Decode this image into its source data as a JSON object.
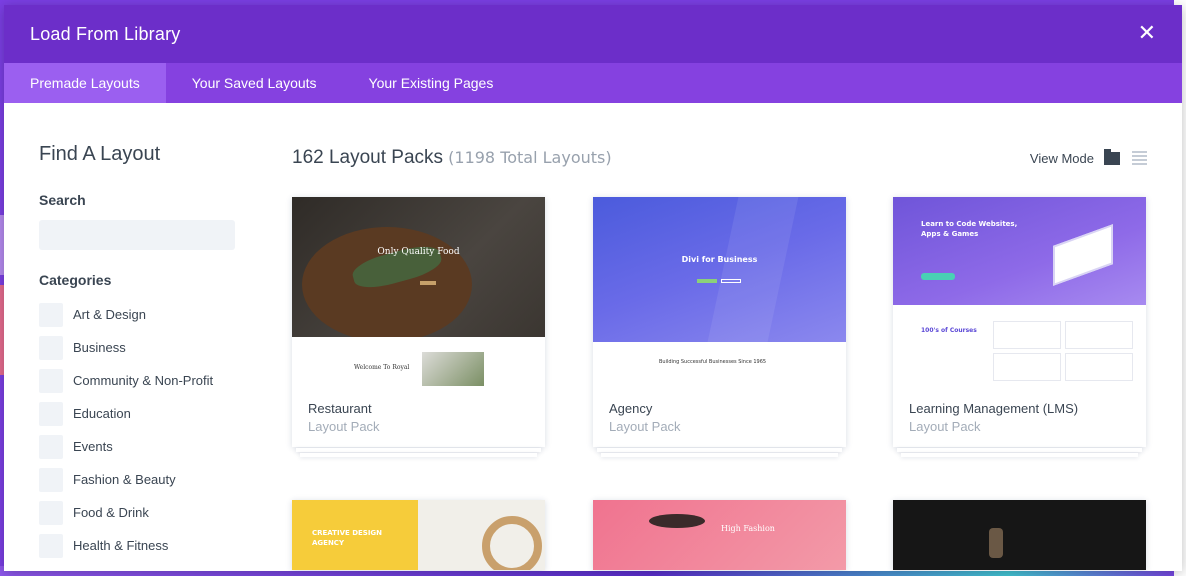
{
  "modal": {
    "title": "Load From Library",
    "close_icon": "close-icon"
  },
  "tabs": [
    {
      "label": "Premade Layouts",
      "active": true
    },
    {
      "label": "Your Saved Layouts",
      "active": false
    },
    {
      "label": "Your Existing Pages",
      "active": false
    }
  ],
  "sidebar": {
    "heading": "Find A Layout",
    "search_label": "Search",
    "search_value": "",
    "categories_label": "Categories",
    "categories": [
      "Art & Design",
      "Business",
      "Community & Non-Profit",
      "Education",
      "Events",
      "Fashion & Beauty",
      "Food & Drink",
      "Health & Fitness"
    ]
  },
  "main": {
    "packs_count": "162 Layout Packs",
    "total_layouts": "(1198 Total Layouts)",
    "view_mode_label": "View Mode",
    "view_mode_icons": [
      "grid-view-icon",
      "list-view-icon"
    ],
    "cards": [
      {
        "name": "Restaurant",
        "sub": "Layout Pack",
        "thumb_title": "Only Quality Food",
        "thumb_text": "Welcome To Royal"
      },
      {
        "name": "Agency",
        "sub": "Layout Pack",
        "thumb_title": "Divi for Business",
        "thumb_text": "Building Successful Businesses Since 1965"
      },
      {
        "name": "Learning Management (LMS)",
        "sub": "Layout Pack",
        "thumb_title": "Learn to Code Websites, Apps & Games",
        "thumb_text": "100's of Courses"
      }
    ],
    "row2": [
      {
        "thumb_title": "CREATIVE DESIGN AGENCY"
      },
      {
        "thumb_title": "High Fashion"
      },
      {
        "thumb_title": ""
      }
    ]
  },
  "colors": {
    "header": "#6c2ec9",
    "tabs": "#8541e0",
    "active_tab": "#9b5ff0",
    "text": "#3a4552",
    "muted": "#a3acb8",
    "input_bg": "#f0f3f7"
  }
}
